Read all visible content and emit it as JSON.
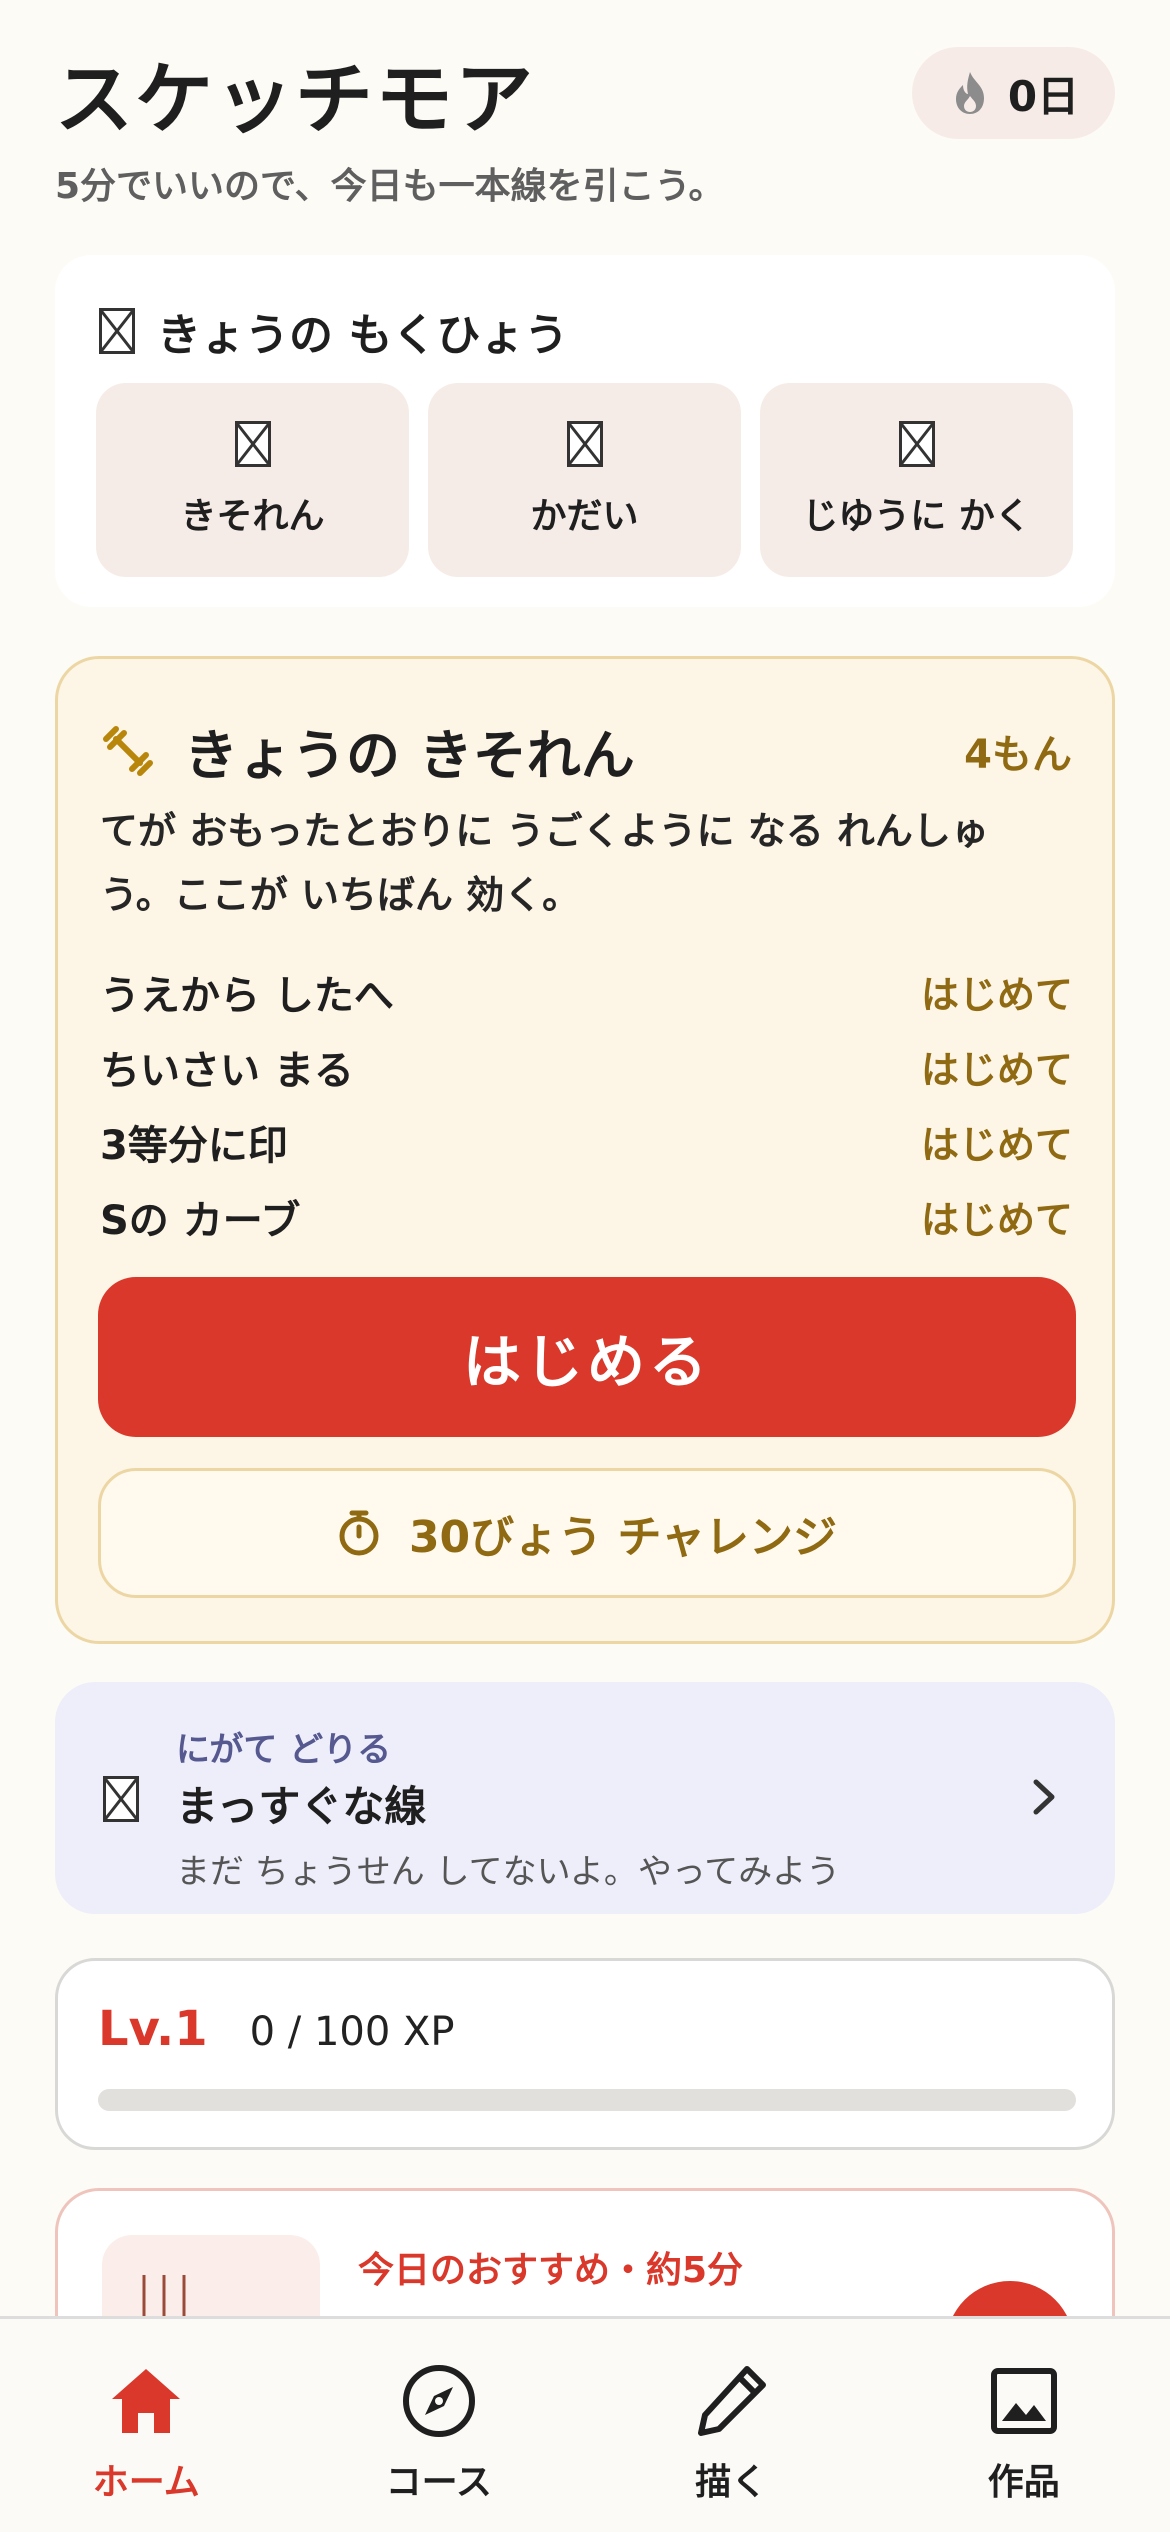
{
  "header": {
    "app_title": "スケッチモア",
    "subtitle": "5分でいいので、今日も一本線を引こう。",
    "streak_days": "0日"
  },
  "goal": {
    "title": "きょうの もくひょう",
    "tiles": [
      {
        "label": "きそれん"
      },
      {
        "label": "かだい"
      },
      {
        "label": "じゆうに かく"
      }
    ]
  },
  "practice": {
    "title": "きょうの きそれん",
    "count": "4もん",
    "description": "てが おもったとおりに うごくように なる れんしゅう。ここが いちばん 効く。",
    "exercises": [
      {
        "name": "うえから したへ",
        "status": "はじめて"
      },
      {
        "name": "ちいさい まる",
        "status": "はじめて"
      },
      {
        "name": "3等分に印",
        "status": "はじめて"
      },
      {
        "name": "Sの カーブ",
        "status": "はじめて"
      }
    ],
    "start_label": "はじめる",
    "challenge_label": "30びょう チャレンジ"
  },
  "weakness": {
    "tag": "にがて どりる",
    "title": "まっすぐな線",
    "subtitle": "まだ ちょうせん してないよ。やってみよう"
  },
  "level": {
    "label": "Lv.1",
    "xp_text": "0 / 100 XP",
    "progress": 0
  },
  "recommendation": {
    "label": "今日のおすすめ・約5分"
  },
  "nav": {
    "items": [
      {
        "label": "ホーム",
        "icon": "home-icon",
        "active": true
      },
      {
        "label": "コース",
        "icon": "compass-icon",
        "active": false
      },
      {
        "label": "描く",
        "icon": "pencil-icon",
        "active": false
      },
      {
        "label": "作品",
        "icon": "image-icon",
        "active": false
      }
    ]
  },
  "colors": {
    "accent": "#d9382a",
    "gold": "#8f6a12",
    "practice_bg": "#fdf5e6",
    "weakness_bg": "#eeeefa"
  }
}
